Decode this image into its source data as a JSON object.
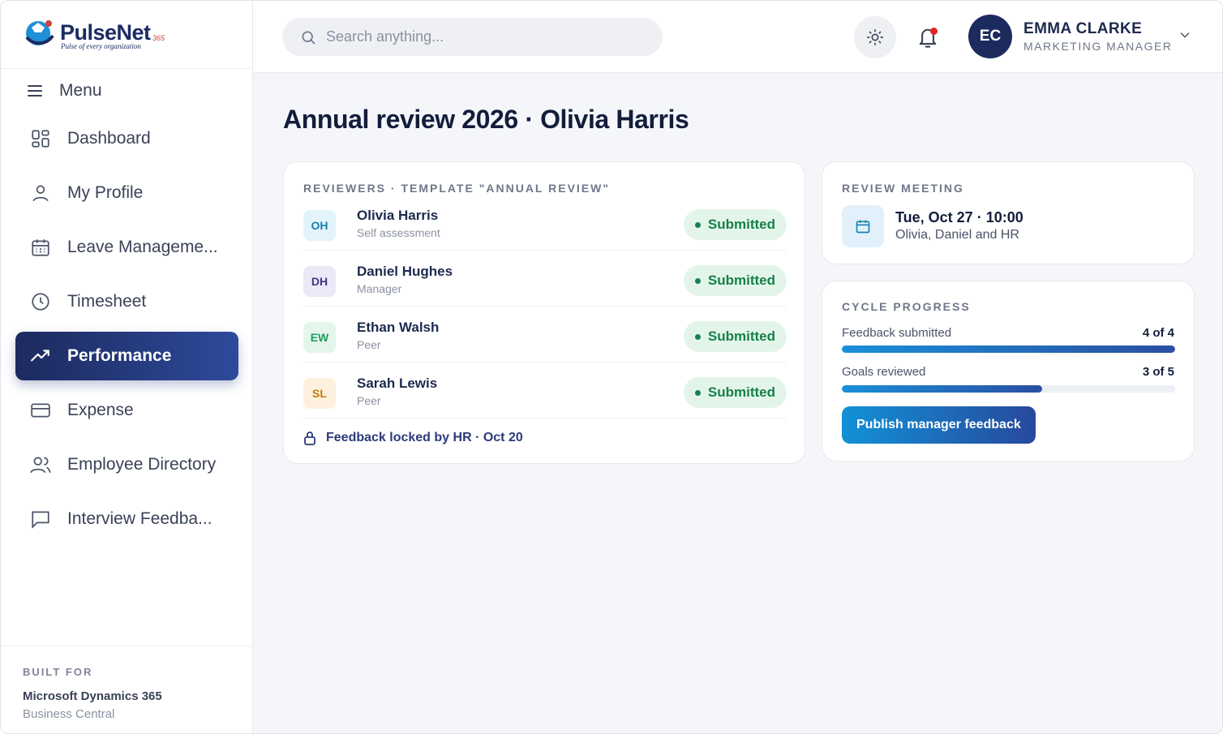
{
  "brand": {
    "name": "PulseNet",
    "sup": "365",
    "tagline": "Pulse of every organization"
  },
  "sidebar": {
    "menu_label": "Menu",
    "items": [
      {
        "label": "Dashboard",
        "icon": "grid-icon"
      },
      {
        "label": "My Profile",
        "icon": "user-icon"
      },
      {
        "label": "Leave Manageme...",
        "icon": "calendar-icon"
      },
      {
        "label": "Timesheet",
        "icon": "clock-icon"
      },
      {
        "label": "Performance",
        "icon": "trend-icon",
        "active": true
      },
      {
        "label": "Expense",
        "icon": "card-icon"
      },
      {
        "label": "Employee Directory",
        "icon": "users-icon"
      },
      {
        "label": "Interview Feedba...",
        "icon": "chat-icon"
      }
    ],
    "built_for": {
      "label": "BUILT FOR",
      "product": "Microsoft Dynamics 365",
      "edition": "Business Central"
    }
  },
  "topbar": {
    "search_placeholder": "Search anything...",
    "user": {
      "initials": "EC",
      "name": "EMMA CLARKE",
      "role": "MARKETING MANAGER"
    }
  },
  "page": {
    "title": "Annual review 2026 · Olivia Harris"
  },
  "reviewers": {
    "label": "REVIEWERS · TEMPLATE \"ANNUAL REVIEW\"",
    "rows": [
      {
        "initials": "OH",
        "name": "Olivia Harris",
        "role": "Self assessment",
        "status": "Submitted",
        "bg": "#e2f3fa",
        "fg": "#1583b0"
      },
      {
        "initials": "DH",
        "name": "Daniel Hughes",
        "role": "Manager",
        "status": "Submitted",
        "bg": "#ebe9f7",
        "fg": "#3b3a7f"
      },
      {
        "initials": "EW",
        "name": "Ethan Walsh",
        "role": "Peer",
        "status": "Submitted",
        "bg": "#e4f5ec",
        "fg": "#1e9a5c"
      },
      {
        "initials": "SL",
        "name": "Sarah Lewis",
        "role": "Peer",
        "status": "Submitted",
        "bg": "#fdf1de",
        "fg": "#c37a13"
      }
    ],
    "locked_note": "Feedback locked by HR · Oct 20"
  },
  "meeting": {
    "label": "REVIEW MEETING",
    "time": "Tue, Oct 27 · 10:00",
    "attendees": "Olivia, Daniel and HR"
  },
  "progress": {
    "label": "CYCLE PROGRESS",
    "items": [
      {
        "label": "Feedback submitted",
        "value": "4 of 4",
        "fraction": 1.0
      },
      {
        "label": "Goals reviewed",
        "value": "3 of 5",
        "fraction": 0.6
      }
    ],
    "button": "Publish manager feedback"
  }
}
